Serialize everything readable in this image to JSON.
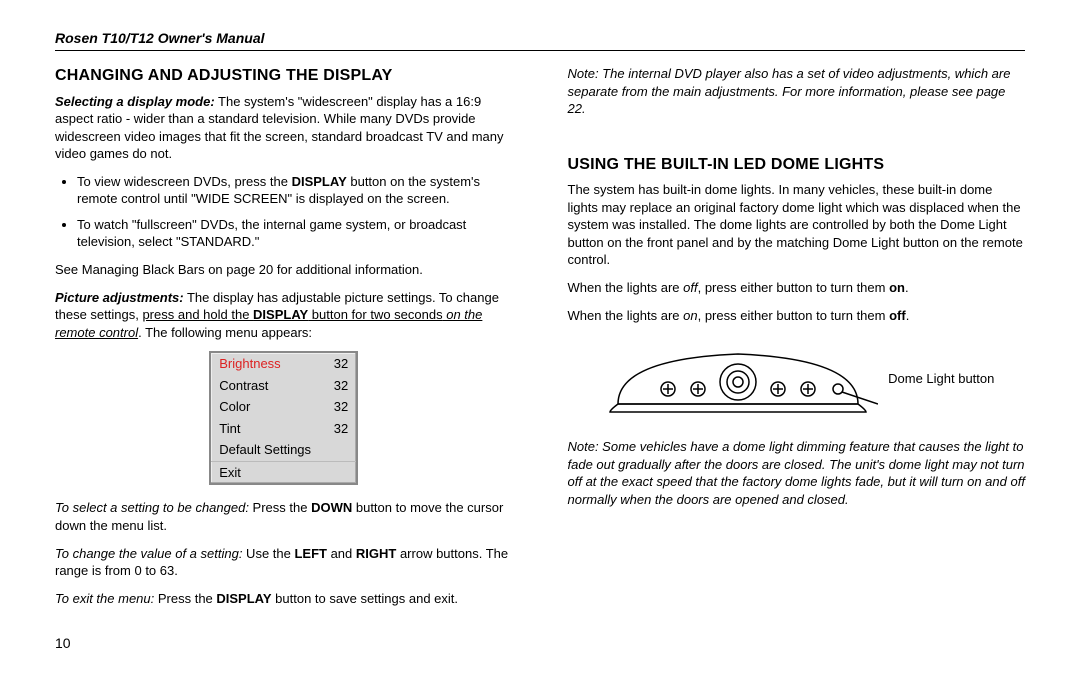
{
  "header": "Rosen T10/T12 Owner's Manual",
  "col1": {
    "heading": "CHANGING AND ADJUSTING THE DISPLAY",
    "p1_lead": "Selecting a display mode:",
    "p1": " The system's \"widescreen\" display has a 16:9 aspect ratio - wider than a standard television. While many DVDs provide widescreen video images that fit the screen, standard broadcast TV and many video games do not.",
    "li1a": "To view widescreen DVDs, press the ",
    "li1b": "DISPLAY",
    "li1c": " button on the system's remote control until \"WIDE SCREEN\" is displayed on the screen.",
    "li2": "To watch \"fullscreen\" DVDs, the internal game system, or broadcast television, select \"STANDARD.\"",
    "p2": "See Managing Black Bars on page 20 for additional information.",
    "p3_lead": "Picture adjustments:",
    "p3a": " The display has adjustable picture settings. To change these settings, ",
    "p3u1": "press and hold the ",
    "p3b": "DISPLAY",
    "p3u2": " button for two seconds",
    "p3i": " on the remote control",
    "p3c": ". The following menu appears:",
    "menu": [
      {
        "label": "Brightness",
        "value": "32",
        "selected": true
      },
      {
        "label": "Contrast",
        "value": "32"
      },
      {
        "label": "Color",
        "value": "32"
      },
      {
        "label": "Tint",
        "value": "32"
      },
      {
        "label": "Default Settings",
        "value": ""
      },
      {
        "label": "Exit",
        "value": "",
        "border": true
      }
    ],
    "p4i": "To select a setting to be changed:",
    "p4a": " Press the ",
    "p4b": "DOWN",
    "p4c": " button to move the cursor down the menu list.",
    "p5i": "To change the value of a setting:",
    "p5a": " Use the ",
    "p5b": "LEFT",
    "p5c": " and ",
    "p5d": "RIGHT",
    "p5e": " arrow buttons. The range is from 0 to 63.",
    "p6i": "To exit the menu:",
    "p6a": " Press the ",
    "p6b": "DISPLAY",
    "p6c": " button to save settings and exit."
  },
  "col2": {
    "note1": "Note: The internal DVD player also has a set of video adjustments, which are separate from the main adjustments. For more information, please see page 22.",
    "heading": "USING THE BUILT-IN LED DOME LIGHTS",
    "p1": "The system has built-in dome lights. In many vehicles, these built-in dome lights may replace an original factory dome light which was displaced when the system was installed. The dome lights are controlled by both the Dome Light button on the front panel and by the matching Dome Light button on the remote control.",
    "p2a": "When the lights are ",
    "p2b": "off",
    "p2c": ", press either button to turn them ",
    "p2d": "on",
    "p2e": ".",
    "p3a": "When the lights are ",
    "p3b": "on",
    "p3c": ", press either button to turn them ",
    "p3d": "off",
    "p3e": ".",
    "callout": "Dome Light button",
    "note2": "Note: Some vehicles have a dome light dimming feature that causes the light to fade out gradually after the doors are closed. The unit's dome light may not turn off at the exact speed that the factory dome lights fade, but it will turn on and off normally when the doors are opened and closed."
  },
  "page": "10"
}
